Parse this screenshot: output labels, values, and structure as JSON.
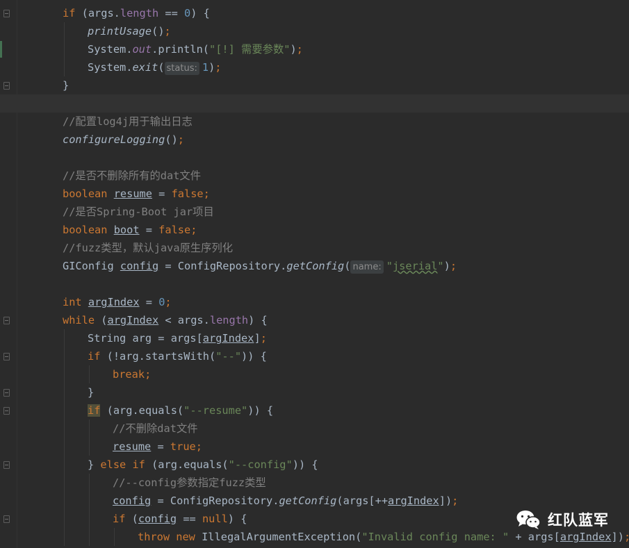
{
  "editor": {
    "lines": [
      {
        "indent": 1,
        "fold": true,
        "segments": [
          {
            "t": "if",
            "c": "kw"
          },
          {
            "t": " (args."
          },
          {
            "t": "length",
            "c": "field"
          },
          {
            "t": " == "
          },
          {
            "t": "0",
            "c": "num"
          },
          {
            "t": ") {"
          }
        ]
      },
      {
        "indent": 2,
        "segments": [
          {
            "t": "printUsage",
            "c": "smeth"
          },
          {
            "t": "()"
          },
          {
            "t": ";",
            "c": "kw"
          }
        ]
      },
      {
        "indent": 2,
        "marker": true,
        "segments": [
          {
            "t": "System."
          },
          {
            "t": "out",
            "c": "sfield"
          },
          {
            "t": ".println("
          },
          {
            "t": "\"[!] 需要参数\"",
            "c": "str"
          },
          {
            "t": ")"
          },
          {
            "t": ";",
            "c": "kw"
          }
        ]
      },
      {
        "indent": 2,
        "segments": [
          {
            "t": "System."
          },
          {
            "t": "exit",
            "c": "smeth"
          },
          {
            "t": "("
          },
          {
            "t": "status:",
            "c": "hint"
          },
          {
            "t": "1",
            "c": "num"
          },
          {
            "t": ")"
          },
          {
            "t": ";",
            "c": "kw"
          }
        ]
      },
      {
        "indent": 1,
        "fold": true,
        "segments": [
          {
            "t": "}"
          }
        ]
      },
      {
        "indent": 1,
        "current": true,
        "segments": []
      },
      {
        "indent": 1,
        "segments": [
          {
            "t": "//配置log4j用于输出日志",
            "c": "cmt"
          }
        ]
      },
      {
        "indent": 1,
        "segments": [
          {
            "t": "configureLogging",
            "c": "smeth"
          },
          {
            "t": "()"
          },
          {
            "t": ";",
            "c": "kw"
          }
        ]
      },
      {
        "indent": 1,
        "segments": []
      },
      {
        "indent": 1,
        "segments": [
          {
            "t": "//是否不删除所有的dat文件",
            "c": "cmt"
          }
        ]
      },
      {
        "indent": 1,
        "segments": [
          {
            "t": "boolean",
            "c": "kw"
          },
          {
            "t": " "
          },
          {
            "t": "resume",
            "c": "var"
          },
          {
            "t": " = "
          },
          {
            "t": "false",
            "c": "kw"
          },
          {
            "t": ";",
            "c": "kw"
          }
        ]
      },
      {
        "indent": 1,
        "segments": [
          {
            "t": "//是否Spring-Boot jar项目",
            "c": "cmt"
          }
        ]
      },
      {
        "indent": 1,
        "segments": [
          {
            "t": "boolean",
            "c": "kw"
          },
          {
            "t": " "
          },
          {
            "t": "boot",
            "c": "var"
          },
          {
            "t": " = "
          },
          {
            "t": "false",
            "c": "kw"
          },
          {
            "t": ";",
            "c": "kw"
          }
        ]
      },
      {
        "indent": 1,
        "segments": [
          {
            "t": "//fuzz类型，默认java原生序列化",
            "c": "cmt"
          }
        ]
      },
      {
        "indent": 1,
        "segments": [
          {
            "t": "GIConfig "
          },
          {
            "t": "config",
            "c": "var"
          },
          {
            "t": " = ConfigRepository."
          },
          {
            "t": "getConfig",
            "c": "smeth"
          },
          {
            "t": "("
          },
          {
            "t": "name:",
            "c": "hint"
          },
          {
            "t": "\"",
            "c": "str"
          },
          {
            "t": "jserial",
            "c": "str typo"
          },
          {
            "t": "\"",
            "c": "str"
          },
          {
            "t": ")"
          },
          {
            "t": ";",
            "c": "kw"
          }
        ]
      },
      {
        "indent": 1,
        "segments": []
      },
      {
        "indent": 1,
        "segments": [
          {
            "t": "int",
            "c": "kw"
          },
          {
            "t": " "
          },
          {
            "t": "argIndex",
            "c": "var"
          },
          {
            "t": " = "
          },
          {
            "t": "0",
            "c": "num"
          },
          {
            "t": ";",
            "c": "kw"
          }
        ]
      },
      {
        "indent": 1,
        "fold": true,
        "segments": [
          {
            "t": "while",
            "c": "kw"
          },
          {
            "t": " ("
          },
          {
            "t": "argIndex",
            "c": "var"
          },
          {
            "t": " < args."
          },
          {
            "t": "length",
            "c": "field"
          },
          {
            "t": ") {"
          }
        ]
      },
      {
        "indent": 2,
        "segments": [
          {
            "t": "String arg = args["
          },
          {
            "t": "argIndex",
            "c": "var"
          },
          {
            "t": "]"
          },
          {
            "t": ";",
            "c": "kw"
          }
        ]
      },
      {
        "indent": 2,
        "fold": true,
        "segments": [
          {
            "t": "if",
            "c": "kw"
          },
          {
            "t": " (!arg.startsWith("
          },
          {
            "t": "\"--\"",
            "c": "str"
          },
          {
            "t": ")) {"
          }
        ]
      },
      {
        "indent": 3,
        "segments": [
          {
            "t": "break",
            "c": "kw"
          },
          {
            "t": ";",
            "c": "kw"
          }
        ]
      },
      {
        "indent": 2,
        "fold": true,
        "segments": [
          {
            "t": "}"
          }
        ]
      },
      {
        "indent": 2,
        "fold": true,
        "segments": [
          {
            "t": "if",
            "c": "kw kwhl"
          },
          {
            "t": " (arg.equals("
          },
          {
            "t": "\"--resume\"",
            "c": "str"
          },
          {
            "t": ")) {"
          }
        ]
      },
      {
        "indent": 3,
        "segments": [
          {
            "t": "//不删除dat文件",
            "c": "cmt"
          }
        ]
      },
      {
        "indent": 3,
        "segments": [
          {
            "t": "resume",
            "c": "var"
          },
          {
            "t": " = "
          },
          {
            "t": "true",
            "c": "kw"
          },
          {
            "t": ";",
            "c": "kw"
          }
        ]
      },
      {
        "indent": 2,
        "fold": true,
        "segments": [
          {
            "t": "} "
          },
          {
            "t": "else if",
            "c": "kw"
          },
          {
            "t": " (arg.equals("
          },
          {
            "t": "\"--config\"",
            "c": "str"
          },
          {
            "t": ")) {"
          }
        ]
      },
      {
        "indent": 3,
        "segments": [
          {
            "t": "//--config参数指定fuzz类型",
            "c": "cmt"
          }
        ]
      },
      {
        "indent": 3,
        "segments": [
          {
            "t": "config",
            "c": "var"
          },
          {
            "t": " = ConfigRepository."
          },
          {
            "t": "getConfig",
            "c": "smeth"
          },
          {
            "t": "(args[++"
          },
          {
            "t": "argIndex",
            "c": "var"
          },
          {
            "t": "])"
          },
          {
            "t": ";",
            "c": "kw"
          }
        ]
      },
      {
        "indent": 3,
        "fold": true,
        "segments": [
          {
            "t": "if",
            "c": "kw"
          },
          {
            "t": " ("
          },
          {
            "t": "config",
            "c": "var"
          },
          {
            "t": " == "
          },
          {
            "t": "null",
            "c": "kw"
          },
          {
            "t": ") {"
          }
        ]
      },
      {
        "indent": 4,
        "segments": [
          {
            "t": "throw new",
            "c": "kw"
          },
          {
            "t": " IllegalArgumentException("
          },
          {
            "t": "\"Invalid config name: \"",
            "c": "str"
          },
          {
            "t": " + args["
          },
          {
            "t": "argIndex",
            "c": "var"
          },
          {
            "t": "])"
          },
          {
            "t": ";",
            "c": "kw"
          }
        ]
      }
    ]
  },
  "watermark": {
    "text": "红队蓝军",
    "icon": "wechat-icon"
  }
}
